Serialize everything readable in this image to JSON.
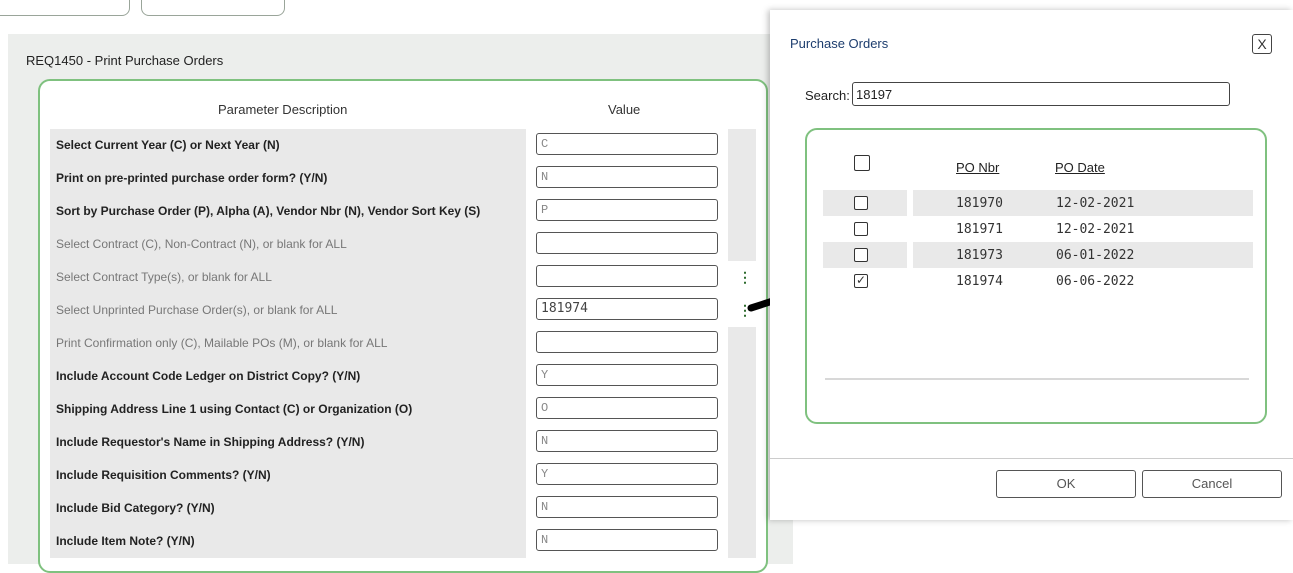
{
  "panel": {
    "title": "REQ1450 - Print Purchase Orders",
    "header_desc": "Parameter Description",
    "header_value": "Value"
  },
  "params": [
    {
      "desc": "Select Current Year (C) or Next Year (N)",
      "value": "C",
      "style": "bold"
    },
    {
      "desc": "Print on pre-printed purchase order form? (Y/N)",
      "value": "N",
      "style": "bold"
    },
    {
      "desc": "Sort by Purchase Order (P), Alpha (A), Vendor Nbr (N), Vendor Sort Key (S)",
      "value": "P",
      "style": "bold"
    },
    {
      "desc": "Select Contract (C), Non-Contract (N), or blank for ALL",
      "value": "",
      "style": "dim"
    },
    {
      "desc": "Select Contract Type(s), or blank for ALL",
      "value": "",
      "style": "dim",
      "kebab": true
    },
    {
      "desc": "Select Unprinted Purchase Order(s), or blank for ALL",
      "value": "181974",
      "style": "dim",
      "kebab": true
    },
    {
      "desc": "Print Confirmation only (C), Mailable POs (M), or blank for ALL",
      "value": "",
      "style": "dim"
    },
    {
      "desc": "Include Account Code Ledger on District Copy? (Y/N)",
      "value": "Y",
      "style": "bold"
    },
    {
      "desc": "Shipping Address Line 1 using Contact (C) or Organization (O)",
      "value": "O",
      "style": "bold"
    },
    {
      "desc": "Include Requestor's Name in Shipping Address? (Y/N)",
      "value": "N",
      "style": "bold"
    },
    {
      "desc": "Include Requisition Comments? (Y/N)",
      "value": "Y",
      "style": "bold"
    },
    {
      "desc": "Include Bid Category? (Y/N)",
      "value": "N",
      "style": "bold"
    },
    {
      "desc": "Include Item Note? (Y/N)",
      "value": "N",
      "style": "bold"
    }
  ],
  "dialog": {
    "title": "Purchase Orders",
    "close_label": "X",
    "search_label": "Search:",
    "search_value": "18197",
    "col_po_nbr": "PO Nbr",
    "col_po_date": "PO Date",
    "rows": [
      {
        "po_nbr": "181970",
        "po_date": "12-02-2021",
        "checked": false
      },
      {
        "po_nbr": "181971",
        "po_date": "12-02-2021",
        "checked": false
      },
      {
        "po_nbr": "181973",
        "po_date": "06-01-2022",
        "checked": false
      },
      {
        "po_nbr": "181974",
        "po_date": "06-06-2022",
        "checked": true
      }
    ],
    "ok_label": "OK",
    "cancel_label": "Cancel"
  },
  "colors": {
    "accent_green": "#7fc17f",
    "title_blue": "#1d3d6e"
  }
}
